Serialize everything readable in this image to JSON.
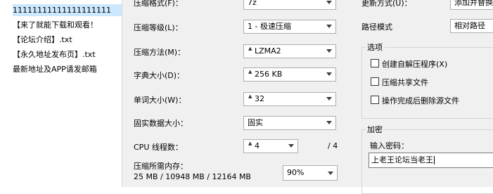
{
  "file_list": [
    {
      "name": "11111111111111111111",
      "type": "folder"
    },
    {
      "name": "【来了就能下载和观看！",
      "type": "txt"
    },
    {
      "name": "【论坛介绍】.txt",
      "type": "txt"
    },
    {
      "name": "【永久地址发布页】.txt",
      "type": "txt"
    },
    {
      "name": "最新地址及APP请发邮箱",
      "type": "txt"
    }
  ],
  "form": {
    "archive_format": {
      "label": "压缩格式(F)：",
      "value": "7z"
    },
    "compression_level": {
      "label": "压缩等级(L)：",
      "value": "1 - 极速压缩"
    },
    "compression_method": {
      "label": "压缩方法(M)：",
      "value": "LZMA2"
    },
    "dictionary_size": {
      "label": "字典大小(D)：",
      "value": "256 KB"
    },
    "word_size": {
      "label": "单词大小(W)：",
      "value": "32"
    },
    "solid_block": {
      "label": "固实数据大小：",
      "value": "固实"
    },
    "cpu_threads": {
      "label": "CPU 线程数：",
      "value": "4",
      "max": "/ 4"
    },
    "memory_usage": {
      "label": "压缩所需内存：",
      "detail": "25 MB / 10948 MB / 12164 MB",
      "percent": "90%"
    }
  },
  "right_panel": {
    "update_mode": {
      "label": "更新方式(U)：",
      "value": "添加并替换"
    },
    "path_mode": {
      "label": "路径模式",
      "value": "相对路径"
    },
    "options": {
      "title": "选项",
      "items": [
        {
          "label": "创建自解压程序(X)",
          "checked": false
        },
        {
          "label": "压缩共享文件",
          "checked": false
        },
        {
          "label": "操作完成后删除源文件",
          "checked": false
        }
      ]
    },
    "encryption": {
      "title": "加密",
      "password_label": "输入密码：",
      "password_value": "上老王论坛当老王"
    }
  }
}
